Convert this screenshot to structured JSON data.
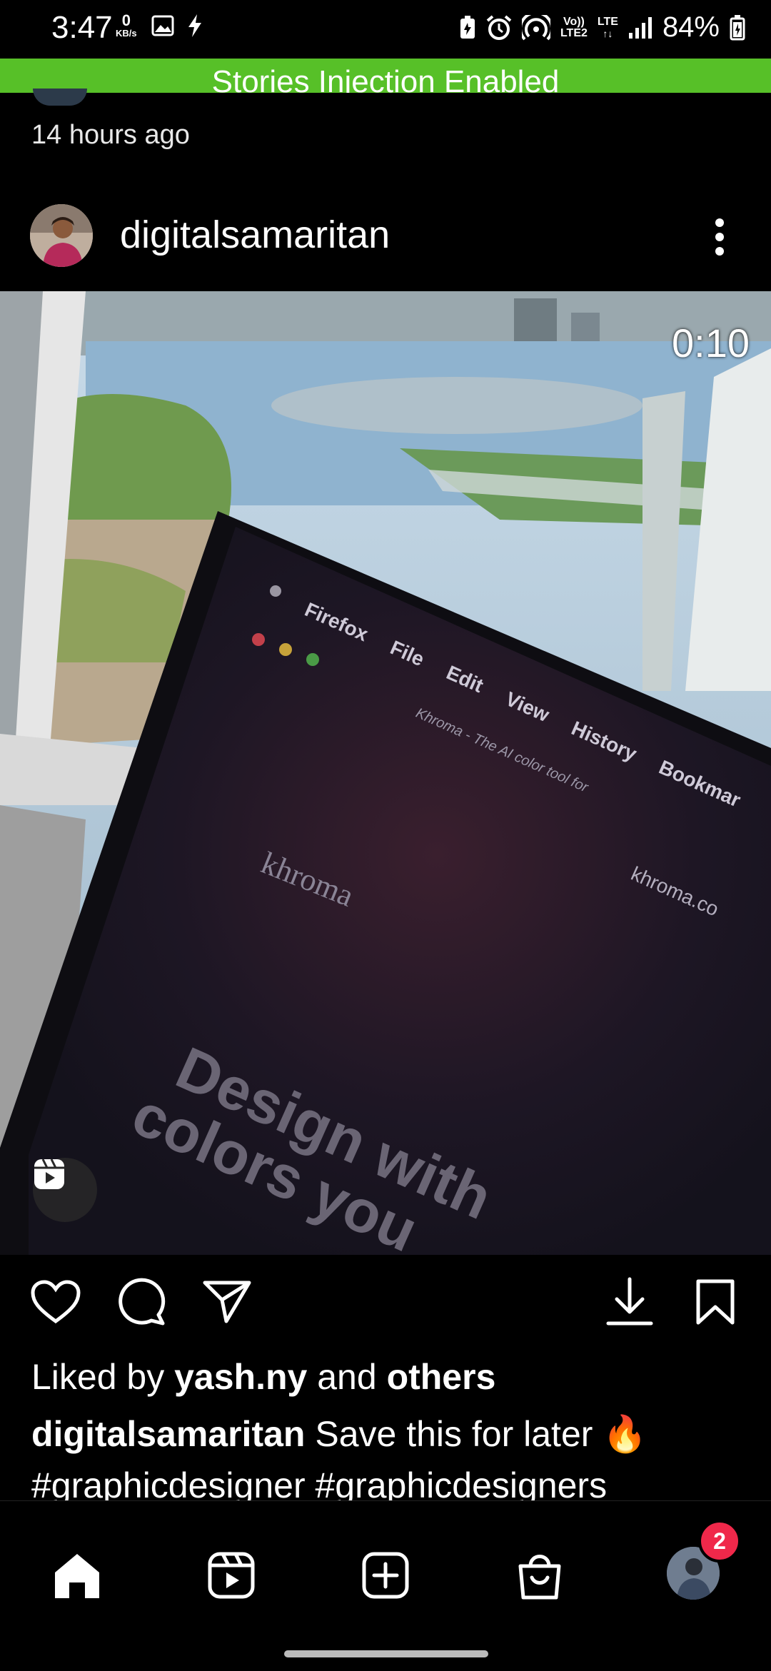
{
  "status_bar": {
    "time": "3:47",
    "net_speed_value": "0",
    "net_speed_unit": "KB/s",
    "volte_top": "Vo))",
    "volte_bottom": "LTE2",
    "lte_label": "LTE",
    "battery": "84%"
  },
  "banner": {
    "text": "Stories Injection Enabled",
    "color": "#57c028"
  },
  "previous_post": {
    "time_ago": "14 hours ago"
  },
  "post": {
    "username": "digitalsamaritan",
    "duration": "0:10",
    "likes_prefix": "Liked by ",
    "likes_user": "yash.ny",
    "likes_mid": " and ",
    "likes_suffix": "others",
    "caption_user": "digitalsamaritan",
    "caption_text": " Save this for later 🔥",
    "hashtags": "#graphicdesigner #graphicdesigners"
  },
  "screen_in_video": {
    "menu": [
      "Firefox",
      "File",
      "Edit",
      "View",
      "History",
      "Bookmar"
    ],
    "tab_title": "Khroma - The AI color tool for",
    "url": "khroma.co",
    "logo": "khroma",
    "headline_line1": "Design with",
    "headline_line2": "colors you"
  },
  "nav": {
    "notification_count": "2"
  },
  "icons": {
    "like": "heart-icon",
    "comment": "comment-icon",
    "share": "send-icon",
    "download": "download-icon",
    "save": "bookmark-icon",
    "home": "home-icon",
    "reels": "reels-icon",
    "create": "add-icon",
    "shop": "shop-icon"
  }
}
